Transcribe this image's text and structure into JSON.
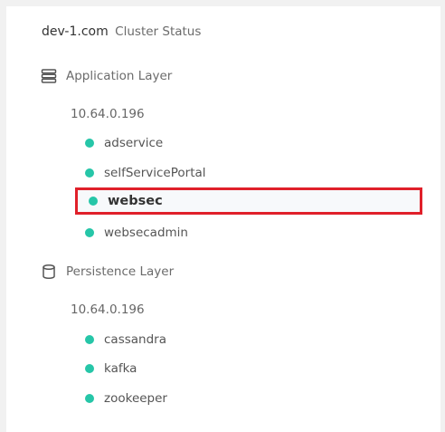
{
  "header": {
    "host": "dev-1.com",
    "subtitle": "Cluster Status"
  },
  "layers": [
    {
      "name": "Application Layer",
      "icon": "stack-icon",
      "ip": "10.64.0.196",
      "services": [
        "adservice",
        "selfServicePortal",
        "websec",
        "websecadmin"
      ],
      "selected": "websec"
    },
    {
      "name": "Persistence Layer",
      "icon": "database-icon",
      "ip": "10.64.0.196",
      "services": [
        "cassandra",
        "kafka",
        "zookeeper"
      ]
    }
  ],
  "colors": {
    "status_ok": "#26c6a8",
    "highlight_border": "#e0202a"
  }
}
